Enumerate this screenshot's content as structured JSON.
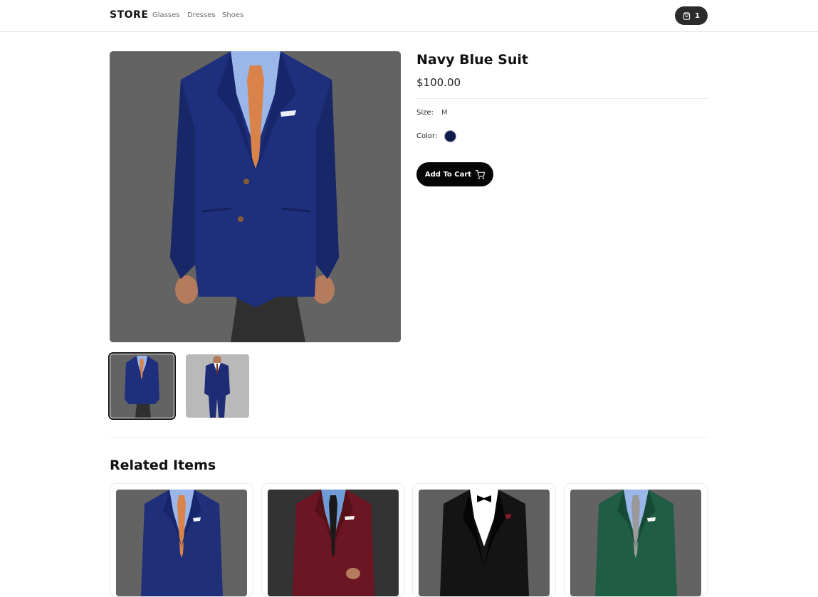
{
  "nav": {
    "brand": "STORE",
    "links": [
      "Glasses",
      "Dresses",
      "Shoes"
    ],
    "cart_count": "1",
    "cart_icon": "shopping-bag-icon"
  },
  "product": {
    "title": "Navy Blue Suit",
    "price": "$100.00",
    "size_label": "Size:",
    "size_value": "M",
    "color_label": "Color:",
    "color_hex": "#0f1c4b",
    "add_to_cart": "Add To Cart",
    "add_icon": "cart-icon"
  },
  "gallery": {
    "thumbnails": [
      "navy-suit-front",
      "navy-suit-full"
    ],
    "selected": 0
  },
  "related": {
    "title": "Related Items",
    "items": [
      {
        "image": "navy-blue-suit",
        "color": "#1f2f7a"
      },
      {
        "image": "burgundy-suit",
        "color": "#6b1622"
      },
      {
        "image": "black-tuxedo",
        "color": "#141414"
      },
      {
        "image": "green-suit",
        "color": "#1f5e45"
      }
    ]
  },
  "colors": {
    "accent": "#050505",
    "border": "#ebebeb",
    "photo_bg": "#636363"
  }
}
